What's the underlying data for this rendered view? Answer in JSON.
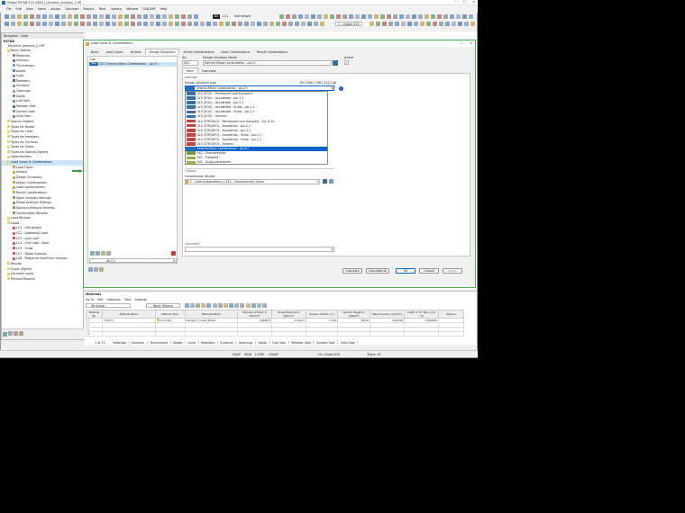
{
  "app": {
    "title": "Global RSTAB 9.01.0003 | Dynamic_analysis_2.rf9",
    "menu": [
      "File",
      "Edit",
      "View",
      "Insert",
      "Assign",
      "Calculate",
      "Results",
      "Tools",
      "Options",
      "Window",
      "CAD-BIM",
      "Help"
    ],
    "lc_badge": "DS",
    "lc_id": "LC1",
    "lc_name": "Self-weight",
    "global_label": "1 - Global XYZ"
  },
  "navigator": {
    "title": "Navigator - Data",
    "root": "RSTAB",
    "project": "Dynamic_analysis_2.rf9*",
    "items": [
      {
        "label": "Basic Objects",
        "level": 1,
        "c": "#f0d060"
      },
      {
        "label": "Materials",
        "level": 2,
        "c": "#a08a60"
      },
      {
        "label": "Sections",
        "level": 2,
        "c": "#5f7fa0"
      },
      {
        "label": "Thicknesses",
        "level": 2,
        "c": "#8aa0b0"
      },
      {
        "label": "Nodes",
        "level": 2,
        "c": "#6080c0"
      },
      {
        "label": "Lines",
        "level": 2,
        "c": "#7090b0"
      },
      {
        "label": "Members",
        "level": 2,
        "c": "#4a6fa0"
      },
      {
        "label": "Surfaces",
        "level": 2,
        "c": "#80a0c0"
      },
      {
        "label": "Openings",
        "level": 2,
        "c": "#90a0b0"
      },
      {
        "label": "Solids",
        "level": 2,
        "c": "#6c8cac"
      },
      {
        "label": "Line Sets",
        "level": 2,
        "c": "#7090b0"
      },
      {
        "label": "Member Sets",
        "level": 2,
        "c": "#4a6fa0"
      },
      {
        "label": "Surface Sets",
        "level": 2,
        "c": "#80a0c0"
      },
      {
        "label": "Solid Sets",
        "level": 2,
        "c": "#6c8cac"
      },
      {
        "label": "Special Objects",
        "level": 1,
        "c": "#f0d060"
      },
      {
        "label": "Types for Nodes",
        "level": 1,
        "c": "#f0d060"
      },
      {
        "label": "Types for Lines",
        "level": 1,
        "c": "#f0d060"
      },
      {
        "label": "Types for Members",
        "level": 1,
        "c": "#f0d060"
      },
      {
        "label": "Types for Surfaces",
        "level": 1,
        "c": "#f0d060"
      },
      {
        "label": "Types for Solids",
        "level": 1,
        "c": "#f0d060"
      },
      {
        "label": "Types for Special Objects",
        "level": 1,
        "c": "#f0d060"
      },
      {
        "label": "Imperfections",
        "level": 1,
        "c": "#f0d060"
      },
      {
        "label": "Load Cases & Combinations",
        "level": 1,
        "c": "#f0d060",
        "selected": true
      },
      {
        "label": "Load Cases",
        "level": 2,
        "c": "#d8a040"
      },
      {
        "label": "Actions",
        "level": 2,
        "c": "#d8a040"
      },
      {
        "label": "Design Situations",
        "level": 2,
        "c": "#d8a040"
      },
      {
        "label": "Action Combinations",
        "level": 2,
        "c": "#d8a040"
      },
      {
        "label": "Load Combinations",
        "level": 2,
        "c": "#d8a040"
      },
      {
        "label": "Result Combinations",
        "level": 2,
        "c": "#d8a040"
      },
      {
        "label": "Static Analysis Settings",
        "level": 2,
        "c": "#80a060"
      },
      {
        "label": "Modal Analysis Settings",
        "level": 2,
        "c": "#80a060"
      },
      {
        "label": "Spectral Analysis Settings",
        "level": 2,
        "c": "#80a060"
      },
      {
        "label": "Combination Wizards",
        "level": 2,
        "c": "#80a060"
      },
      {
        "label": "Load Wizards",
        "level": 1,
        "c": "#f0d060"
      },
      {
        "label": "Loads",
        "level": 1,
        "c": "#f0d060"
      },
      {
        "label": "LC1 - Self-weight",
        "level": 2,
        "c": "#c86060"
      },
      {
        "label": "LC2 - Additional Load",
        "level": 2,
        "c": "#c86060"
      },
      {
        "label": "LC3 - Live Load",
        "level": 2,
        "c": "#c86060"
      },
      {
        "label": "LC4 - Live Load - Roof",
        "level": 2,
        "c": "#c86060"
      },
      {
        "label": "LC5 - Snow",
        "level": 2,
        "c": "#c86060"
      },
      {
        "label": "LC7 - Modal Analysis",
        "level": 2,
        "c": "#c86060"
      },
      {
        "label": "LC8 - Response Spectrum Analysis",
        "level": 2,
        "c": "#c86060"
      },
      {
        "label": "Results",
        "level": 1,
        "c": "#f0d060"
      },
      {
        "label": "Guide Objects",
        "level": 1,
        "c": "#f0d060"
      },
      {
        "label": "Dynamic Loads",
        "level": 1,
        "c": "#f0d060"
      },
      {
        "label": "Printout Reports",
        "level": 1,
        "c": "#f0d060"
      }
    ]
  },
  "dialog": {
    "title": "Load Cases & Combinations",
    "tabs": [
      "Basic",
      "Load Cases",
      "Actions",
      "Design Situations",
      "Action Combinations",
      "Load Combinations",
      "Result Combinations"
    ],
    "active_tab": "Design Situations",
    "list_header": "List",
    "list_item_badge": "DS1",
    "list_item_text": "DS1  Seismic/Mass Combination - psi-E,i",
    "all_label": "All (1)",
    "no_label": "No.",
    "no_value": "DS1",
    "name_label": "Design Situation Name",
    "name_value": "Seismic/Mass Combination - psi-E,i",
    "active_label": "Active",
    "subtabs": [
      "Main",
      "Overview"
    ],
    "settings_label": "Settings",
    "ds_type_label": "Design situation type",
    "standard": "EN 1990 | DIN | 2012-08",
    "ds_type_selected": "Seismic/Mass Combination - psi-E,i",
    "options": [
      {
        "tag": "STR",
        "text": "ULS (EQU) - Permanent and transient",
        "c": "#3a6ea8"
      },
      {
        "tag": "STR",
        "text": "ULS (EQU) - Accidental - psi-1,1",
        "c": "#3a6ea8"
      },
      {
        "tag": "STR",
        "text": "ULS (EQU) - Accidental - psi-2,1",
        "c": "#3a6ea8"
      },
      {
        "tag": "STR",
        "text": "ULS (EQU) - Accidental - Snow - psi-1,1",
        "c": "#3a6ea8"
      },
      {
        "tag": "STR",
        "text": "ULS (EQU) - Accidental - Snow - psi-2,1",
        "c": "#3a6ea8"
      },
      {
        "tag": "STR",
        "text": "ULS (EQU) - Seismic",
        "c": "#3a6ea8"
      },
      {
        "tag": "GEO",
        "text": "ULS (STR/GEO) - Permanent and transient - Eq. 6.10",
        "c": "#c84040"
      },
      {
        "tag": "GEO",
        "text": "ULS (STR/GEO) - Accidental - psi-1,1",
        "c": "#c84040"
      },
      {
        "tag": "GEO",
        "text": "ULS (STR/GEO) - Accidental - psi-2,1",
        "c": "#c84040"
      },
      {
        "tag": "GEO",
        "text": "ULS (STR/GEO) - Accidental - Snow - psi-1,1",
        "c": "#c84040"
      },
      {
        "tag": "GEO",
        "text": "ULS (STR/GEO) - Accidental - Snow - psi-2,1",
        "c": "#c84040"
      },
      {
        "tag": "GEO",
        "text": "ULS (STR/GEO) - Seismic",
        "c": "#c84040"
      },
      {
        "tag": "SE",
        "text": "Seismic/Mass Combination - psi-E,i",
        "c": "#2a6fb0",
        "selected": true
      },
      {
        "tag": "SLS",
        "text": "SLS - Characteristic",
        "c": "#70a040"
      },
      {
        "tag": "SLS",
        "text": "SLS - Frequent",
        "c": "#90b040"
      },
      {
        "tag": "SLS",
        "text": "SLS - Quasi-permanent",
        "c": "#a0b050"
      }
    ],
    "options_label": "Options",
    "wizard_label": "Combination Wizard",
    "wizard_value": "2 - Load combinations | SA1 - Geometrically linear",
    "comment_label": "Comment",
    "buttons": {
      "calculate": "Calculate",
      "calculate_all": "Calculate All",
      "ok": "OK",
      "cancel": "Cancel",
      "apply": "Apply"
    }
  },
  "materials": {
    "title": "Materials",
    "menu": [
      "Go To",
      "Edit",
      "Selection",
      "View",
      "Settings"
    ],
    "filter": "Structure",
    "filter2": "Basic Objects",
    "columns": [
      "Material No.",
      "Material Name",
      "Material Type",
      "Material Model",
      "Modulus of Elast. E [N/mm²]",
      "Shear Modulus G [N/mm²]",
      "Poisson's Ratio ν [-]",
      "Specific Weight γ [kN/m³]",
      "Mass Density ρ [kg/m³]",
      "Coeff. of Th. Exp. α [1/°C]",
      "Options"
    ],
    "rows": [
      {
        "no": "1",
        "name": "C30/37",
        "type": "Concrete",
        "model": "Isotropic | Linear Elastic",
        "e": "33000.0",
        "g": "13750.0",
        "nu": "0.200",
        "gamma": "25.00",
        "rho": "2500.00",
        "alpha": "0.000010"
      },
      {
        "no": "2"
      },
      {
        "no": "3"
      },
      {
        "no": "4"
      }
    ],
    "pager": "1 of 13",
    "tabs": [
      "Materials",
      "Sections",
      "Thicknesses",
      "Nodes",
      "Lines",
      "Members",
      "Surfaces",
      "Openings",
      "Solids",
      "Line Sets",
      "Member Sets",
      "Surface Sets",
      "Solid Sets"
    ]
  },
  "statusbar": {
    "items": [
      "SNAP",
      "GRID",
      "LGRID",
      "OSNAP"
    ],
    "cs": "CS: Global XYZ",
    "plane": "Plane: XY"
  },
  "colors": {
    "selected": "#0a64c8",
    "accent": "#3fa04a"
  }
}
